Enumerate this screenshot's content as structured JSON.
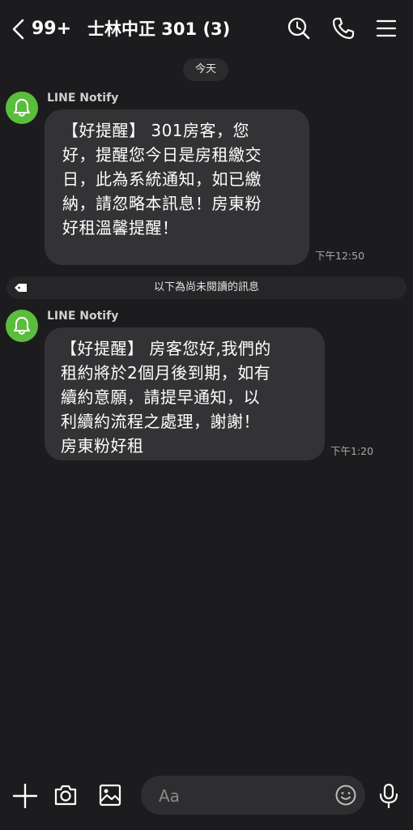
{
  "header": {
    "unread_count": "99+",
    "title": "士林中正 301 (3)"
  },
  "date_divider": "今天",
  "unread_divider": "以下為尚未閱讀的訊息",
  "messages": [
    {
      "sender": "LINE Notify",
      "text": "【好提醒】 301房客，您\n好，提醒您今日是房租繳交\n日，此為系統通知，如已繳\n納，請忽略本訊息！房東粉\n好租溫馨提醒！",
      "time": "下午12:50"
    },
    {
      "sender": "LINE Notify",
      "text": "【好提醒】 房客您好,我們的\n租約將於2個月後到期，如有\n續約意願，請提早通知，以\n利續約流程之處理，謝謝！\n房東粉好租",
      "time": "下午1:20"
    }
  ],
  "composer": {
    "placeholder": "Aa"
  },
  "icons": {
    "back": "chevron-left-icon",
    "search": "search-icon",
    "call": "phone-icon",
    "menu": "menu-icon",
    "avatar": "bell-icon",
    "plus": "plus-icon",
    "camera": "camera-icon",
    "image": "image-icon",
    "emoji": "emoji-icon",
    "mic": "mic-icon"
  },
  "colors": {
    "background": "#1c1c1e",
    "bubble": "#333335",
    "avatar": "#5bbd3c"
  }
}
